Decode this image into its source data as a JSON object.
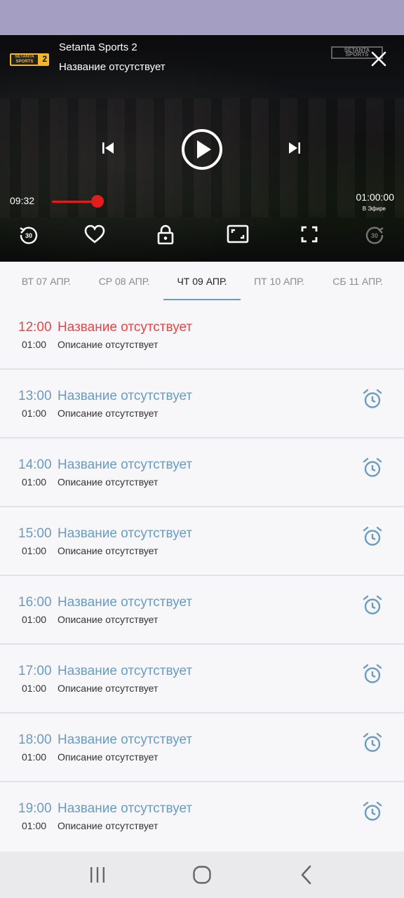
{
  "player": {
    "channel_logo_text": "SETANTA SPORTS",
    "channel_logo_num": "2",
    "channel_name": "Setanta Sports 2",
    "program_title": "Название отсутствует",
    "watermark": "SETANTA SPORTS",
    "current_time": "09:32",
    "total_time": "01:00:00",
    "live_label": "В Эфире",
    "progress_percent": 9,
    "icons": {
      "close": "close-icon",
      "prev": "skip-previous-icon",
      "play": "play-icon",
      "next": "skip-next-icon",
      "rewind": "replay-30-icon",
      "favorite": "heart-icon",
      "lock": "lock-icon",
      "aspect": "aspect-ratio-icon",
      "fullscreen": "fullscreen-icon",
      "forward": "forward-30-icon"
    },
    "accent": "#e21d1d"
  },
  "tabs": [
    {
      "label": "ВТ 07 АПР."
    },
    {
      "label": "СР 08 АПР."
    },
    {
      "label": "ЧТ 09 АПР."
    },
    {
      "label": "ПТ 10 АПР."
    },
    {
      "label": "СБ 11 АПР."
    }
  ],
  "active_tab": 2,
  "schedule": [
    {
      "time": "12:00",
      "title": "Название отсутствует",
      "duration": "01:00",
      "description": "Описание отсутствует",
      "current": true
    },
    {
      "time": "13:00",
      "title": "Название отсутствует",
      "duration": "01:00",
      "description": "Описание отсутствует",
      "current": false
    },
    {
      "time": "14:00",
      "title": "Название отсутствует",
      "duration": "01:00",
      "description": "Описание отсутствует",
      "current": false
    },
    {
      "time": "15:00",
      "title": "Название отсутствует",
      "duration": "01:00",
      "description": "Описание отсутствует",
      "current": false
    },
    {
      "time": "16:00",
      "title": "Название отсутствует",
      "duration": "01:00",
      "description": "Описание отсутствует",
      "current": false
    },
    {
      "time": "17:00",
      "title": "Название отсутствует",
      "duration": "01:00",
      "description": "Описание отсутствует",
      "current": false
    },
    {
      "time": "18:00",
      "title": "Название отсутствует",
      "duration": "01:00",
      "description": "Описание отсутствует",
      "current": false
    },
    {
      "time": "19:00",
      "title": "Название отсутствует",
      "duration": "01:00",
      "description": "Описание отсутствует",
      "current": false
    }
  ],
  "colors": {
    "current_program": "#e84545",
    "upcoming_program": "#6a9bc0",
    "status_bar": "#a39ec2"
  },
  "navbar": {
    "recents": "recents-icon",
    "home": "home-icon",
    "back": "back-icon"
  }
}
